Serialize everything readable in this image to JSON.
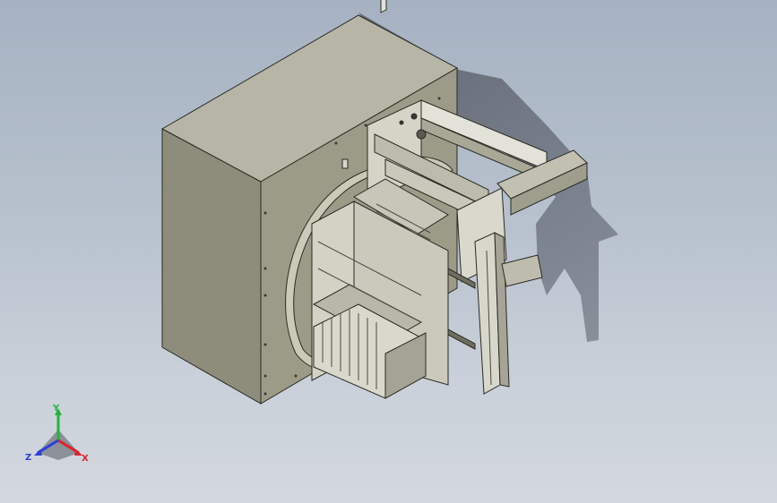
{
  "triad": {
    "x_label": "X",
    "y_label": "Y",
    "z_label": "Z",
    "x_color": "#e0202a",
    "y_color": "#22b33a",
    "z_color": "#2d3fd8"
  },
  "colors": {
    "background_top": "#a6b2c2",
    "background_bottom": "#d3d8de",
    "cabinet_side": "#8e8d7b",
    "cabinet_front": "#9c9b88",
    "cabinet_top": "#b7b6a6",
    "edge": "#2a2a24"
  }
}
